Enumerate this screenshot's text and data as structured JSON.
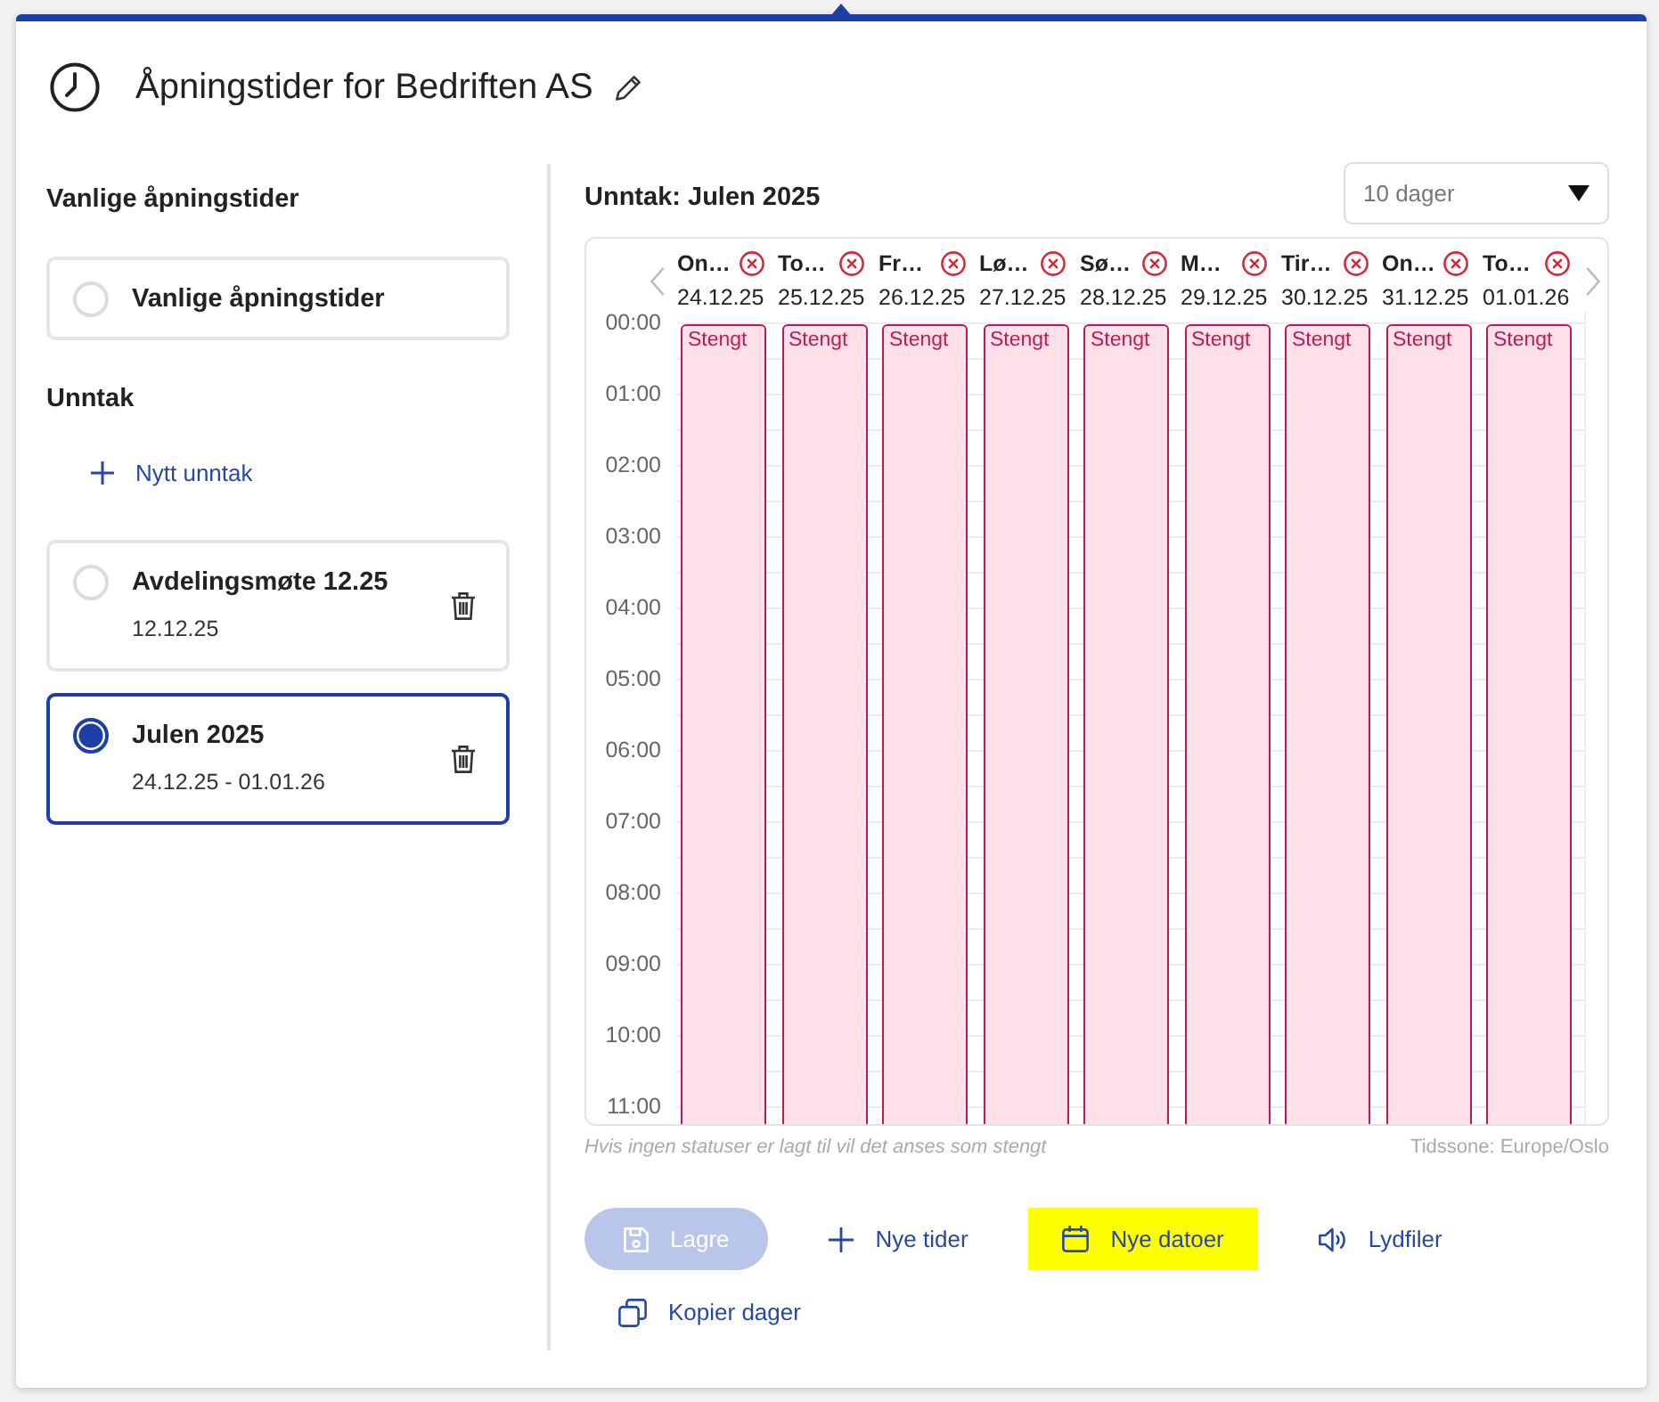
{
  "header": {
    "title": "Åpningstider for Bedriften AS"
  },
  "sidebar": {
    "regular": {
      "heading": "Vanlige åpningstider",
      "option": {
        "label": "Vanlige åpningstider",
        "selected": false
      }
    },
    "exceptions": {
      "heading": "Unntak",
      "add_button": "Nytt unntak",
      "items": [
        {
          "name": "Avdelingsmøte 12.25",
          "dates": "12.12.25",
          "selected": false
        },
        {
          "name": "Julen 2025",
          "dates": "24.12.25 - 01.01.26",
          "selected": true
        }
      ]
    }
  },
  "schedule": {
    "title": "Unntak: Julen 2025",
    "range_select": {
      "value": "10 dager"
    },
    "days": [
      {
        "name": "On…",
        "date": "24.12.25",
        "block": "Stengt"
      },
      {
        "name": "To…",
        "date": "25.12.25",
        "block": "Stengt"
      },
      {
        "name": "Fr…",
        "date": "26.12.25",
        "block": "Stengt"
      },
      {
        "name": "Lø…",
        "date": "27.12.25",
        "block": "Stengt"
      },
      {
        "name": "Sø…",
        "date": "28.12.25",
        "block": "Stengt"
      },
      {
        "name": "M…",
        "date": "29.12.25",
        "block": "Stengt"
      },
      {
        "name": "Tir…",
        "date": "30.12.25",
        "block": "Stengt"
      },
      {
        "name": "On…",
        "date": "31.12.25",
        "block": "Stengt"
      },
      {
        "name": "To…",
        "date": "01.01.26",
        "block": "Stengt"
      }
    ],
    "times": [
      "00:00",
      "01:00",
      "02:00",
      "03:00",
      "04:00",
      "05:00",
      "06:00",
      "07:00",
      "08:00",
      "09:00",
      "10:00",
      "11:00"
    ],
    "note": "Hvis ingen statuser er lagt til vil det anses som stengt",
    "timezone": "Tidssone: Europe/Oslo"
  },
  "actions": [
    {
      "kind": "save",
      "label": "Lagre",
      "disabled": true,
      "highlighted": false
    },
    {
      "kind": "add",
      "label": "Nye tider",
      "disabled": false,
      "highlighted": false
    },
    {
      "kind": "calendar",
      "label": "Nye datoer",
      "disabled": false,
      "highlighted": true
    },
    {
      "kind": "audio",
      "label": "Lydfiler",
      "disabled": false,
      "highlighted": false
    },
    {
      "kind": "copy",
      "label": "Kopier dager",
      "disabled": false,
      "highlighted": false
    }
  ]
}
